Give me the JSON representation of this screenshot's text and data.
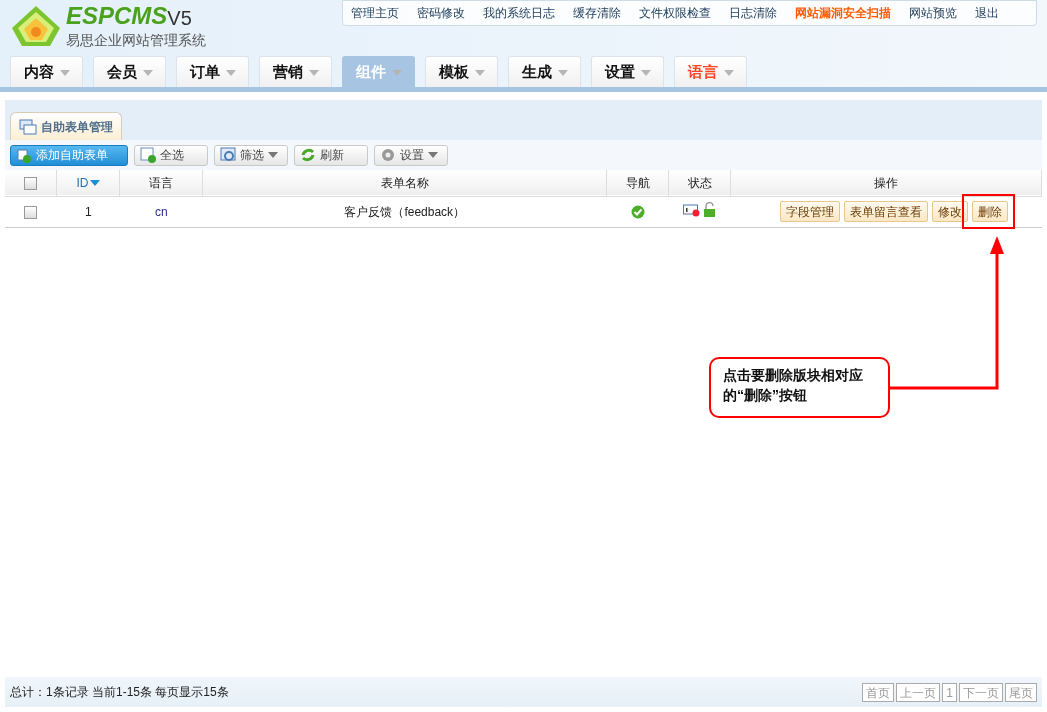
{
  "header": {
    "logo_text": "ESPCMS",
    "logo_version": "V5",
    "subtitle": "易思企业网站管理系统",
    "top_links": [
      {
        "label": "管理主页",
        "highlight": false
      },
      {
        "label": "密码修改",
        "highlight": false
      },
      {
        "label": "我的系统日志",
        "highlight": false
      },
      {
        "label": "缓存清除",
        "highlight": false
      },
      {
        "label": "文件权限检查",
        "highlight": false
      },
      {
        "label": "日志清除",
        "highlight": false
      },
      {
        "label": "网站漏洞安全扫描",
        "highlight": true
      },
      {
        "label": "网站预览",
        "highlight": false
      },
      {
        "label": "退出",
        "highlight": false
      }
    ]
  },
  "nav_tabs": [
    {
      "label": "内容",
      "selected": false,
      "color": "#111111"
    },
    {
      "label": "会员",
      "selected": false,
      "color": "#111111"
    },
    {
      "label": "订单",
      "selected": false,
      "color": "#111111"
    },
    {
      "label": "营销",
      "selected": false,
      "color": "#111111"
    },
    {
      "label": "组件",
      "selected": true,
      "color": "#ffffff"
    },
    {
      "label": "模板",
      "selected": false,
      "color": "#111111"
    },
    {
      "label": "生成",
      "selected": false,
      "color": "#111111"
    },
    {
      "label": "设置",
      "selected": false,
      "color": "#111111"
    },
    {
      "label": "语言",
      "selected": false,
      "color": "#ff4422"
    }
  ],
  "panel_tab": "自助表单管理",
  "toolbar": [
    {
      "kind": "primary",
      "label": "添加自助表单",
      "dropdown": false
    },
    {
      "kind": "plain",
      "label": "全选",
      "dropdown": false
    },
    {
      "kind": "plain",
      "label": "筛选",
      "dropdown": true
    },
    {
      "kind": "plain",
      "label": "刷新",
      "dropdown": false
    },
    {
      "kind": "plain",
      "label": "设置",
      "dropdown": true
    }
  ],
  "table": {
    "columns": [
      "ID",
      "语言",
      "表单名称",
      "导航",
      "状态",
      "操作"
    ],
    "header_checked": false,
    "rows": [
      {
        "checked": false,
        "id": "1",
        "lang": "cn",
        "name": "客户反馈（feedback）",
        "actions": [
          "字段管理",
          "表单留言查看",
          "修改",
          "删除"
        ]
      }
    ]
  },
  "footer": {
    "summary": "总计：1条记录 当前1-15条 每页显示15条",
    "pager": [
      {
        "label": "首页",
        "disabled": true
      },
      {
        "label": "上一页",
        "disabled": true
      },
      {
        "label": "1",
        "disabled": true
      },
      {
        "label": "下一页",
        "disabled": true
      },
      {
        "label": "尾页",
        "disabled": true
      }
    ]
  },
  "annotation": {
    "text": "点击要删除版块相对应的“删除”按钮"
  }
}
